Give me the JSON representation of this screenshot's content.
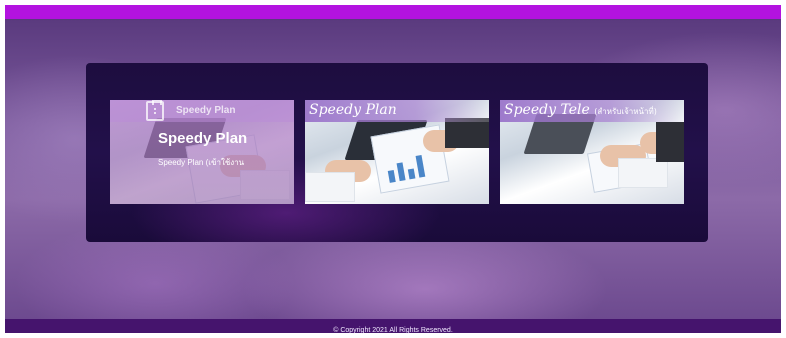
{
  "page": {
    "topbar_color": "#b313e0",
    "footer_color": "#45146d"
  },
  "cards": [
    {
      "brand": "Speedy Plan",
      "title": "Speedy Plan",
      "subtitle": "Speedy Plan (เข้าใช้งาน",
      "icon": "clipboard-icon",
      "state": "hovered"
    },
    {
      "banner": "Speedy Plan"
    },
    {
      "banner": "Speedy Tele",
      "banner_suffix": "(สำหรับเจ้าหน้าที่)"
    }
  ],
  "footer": {
    "copyright": "© Copyright 2021 All Rights Reserved."
  }
}
